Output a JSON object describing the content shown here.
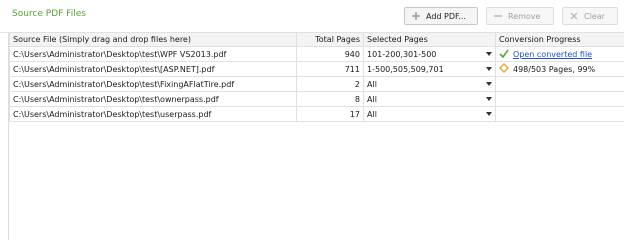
{
  "header": {
    "title": "Source PDF Files",
    "add_label": "Add PDF...",
    "remove_label": "Remove",
    "clear_label": "Clear"
  },
  "table": {
    "columns": [
      "Source File (Simply drag and drop files here)",
      "Total Pages",
      "Selected Pages",
      "Conversion Progress"
    ],
    "rows": [
      {
        "file": "C:\\Users\\Administrator\\Desktop\\test\\WPF VS2013.pdf",
        "pages": "940",
        "selected": "101-200,301-500",
        "progress": "Open converted file",
        "status": "done"
      },
      {
        "file": "C:\\Users\\Administrator\\Desktop\\test\\[ASP.NET].pdf",
        "pages": "711",
        "selected": "1-500,505,509,701",
        "progress": "498/503 Pages, 99%",
        "status": "progress"
      },
      {
        "file": "C:\\Users\\Administrator\\Desktop\\test\\FixingAFlatTire.pdf",
        "pages": "2",
        "selected": "All",
        "progress": "",
        "status": "none"
      },
      {
        "file": "C:\\Users\\Administrator\\Desktop\\test\\ownerpass.pdf",
        "pages": "8",
        "selected": "All",
        "progress": "",
        "status": "none"
      },
      {
        "file": "C:\\Users\\Administrator\\Desktop\\test\\userpass.pdf",
        "pages": "17",
        "selected": "All",
        "progress": "",
        "status": "none"
      }
    ]
  },
  "colors": {
    "accent": "#5aa13a",
    "link": "#1a55c8",
    "progress_icon": "#e8a33b"
  }
}
